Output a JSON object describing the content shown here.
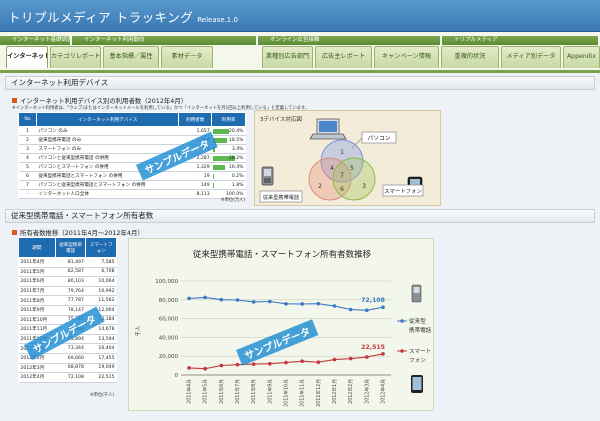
{
  "app": {
    "title": "トリプルメディア トラッキング",
    "release": "Release.1.0"
  },
  "nav": {
    "groups": [
      {
        "label": "インターネット基礎調査",
        "left": 0,
        "width": 72
      },
      {
        "label": "インターネット利用動向",
        "left": 72,
        "width": 186
      },
      {
        "label": "オンライン広告接触",
        "left": 258,
        "width": 184
      },
      {
        "label": "トリプルメディア",
        "left": 442,
        "width": 158
      }
    ],
    "tabs": [
      {
        "label": "インターネット入口",
        "active": true
      },
      {
        "label": "カテゴリレポート",
        "active": false
      },
      {
        "label": "基本指標／属性",
        "active": false
      },
      {
        "label": "素材データ",
        "active": false
      },
      {
        "label": "業種別広告部門",
        "active": false
      },
      {
        "label": "広告主レポート",
        "active": false
      },
      {
        "label": "キャンペーン情報",
        "active": false
      },
      {
        "label": "重複的状況",
        "active": false
      },
      {
        "label": "メディア別データ",
        "active": false
      },
      {
        "label": "Appendix",
        "active": false
      }
    ]
  },
  "sections": {
    "devices_title": "インターネット利用デバイス",
    "device_table_title": "インターネット利用デバイス別の利用者数（2012年4月）",
    "device_note": "※インターネット利用者は、「ウェブ)またはインターネットメールを利用している」かつ「インターネットを月1回以上利用している」と定義しています。",
    "device_unit": "※単位(万人)",
    "mobile_title": "従来型携帯電話・スマートフォン所有者数",
    "mobile_table_title": "所有者数推移（2011年4月〜2012年4月）",
    "mobile_unit": "※単位(千人)"
  },
  "device_table": {
    "headers": [
      "No",
      "インターネット利用デバイス",
      "利用者数",
      "利用率"
    ],
    "rows": [
      {
        "no": "1",
        "device": "パソコン のみ",
        "count": "1,657",
        "pct": "20.4%",
        "pct_value": 20.4
      },
      {
        "no": "2",
        "device": "従来型携帯電話 のみ",
        "count": "1,504",
        "pct": "18.5%",
        "pct_value": 18.5
      },
      {
        "no": "3",
        "device": "スマートフォン のみ",
        "count": "274",
        "pct": "3.4%",
        "pct_value": 3.4
      },
      {
        "no": "4",
        "device": "パソコンと従来型携帯電話 の併用",
        "count": "2,287",
        "pct": "28.2%",
        "pct_value": 28.2
      },
      {
        "no": "5",
        "device": "パソコンとスマートフォン の併用",
        "count": "1,329",
        "pct": "16.4%",
        "pct_value": 16.4
      },
      {
        "no": "6",
        "device": "従来型携帯電話とスマートフォン の併用",
        "count": "19",
        "pct": "0.2%",
        "pct_value": 0.2
      },
      {
        "no": "7",
        "device": "パソコンと従来型携帯電話とスマートフォン の併用",
        "count": "149",
        "pct": "1.8%",
        "pct_value": 1.8
      }
    ],
    "total": {
      "no": "-",
      "device": "インターネット人口全体",
      "count": "8,113",
      "pct": "100.0%"
    }
  },
  "venn": {
    "title": "3デバイス対応図",
    "labels": {
      "pc": "パソコン",
      "feature": "従来型携帯電話",
      "smart": "スマートフォン"
    },
    "regions": [
      "1",
      "2",
      "3",
      "4",
      "5",
      "6",
      "7"
    ]
  },
  "mobile_table": {
    "headers": [
      "期間",
      "従来型携帯電話",
      "スマートフォン"
    ],
    "rows": [
      [
        "2011年4月",
        "81,497",
        "7,585"
      ],
      [
        "2011年5月",
        "82,587",
        "6,708"
      ],
      [
        "2011年6月",
        "80,103",
        "10,064"
      ],
      [
        "2011年7月",
        "79,764",
        "10,992"
      ],
      [
        "2011年8月",
        "77,787",
        "11,562"
      ],
      [
        "2011年9月",
        "78,147",
        "12,004"
      ],
      [
        "2011年10月",
        "75,710",
        "13,184"
      ],
      [
        "2011年11月",
        "75,548",
        "14,678"
      ],
      [
        "2011年12月",
        "75,894",
        "13,594"
      ],
      [
        "2012年1月",
        "73,344",
        "16,404"
      ],
      [
        "2012年2月",
        "69,660",
        "17,455"
      ],
      [
        "2012年3月",
        "68,878",
        "19,049"
      ],
      [
        "2012年4月",
        "72,108",
        "22,515"
      ]
    ]
  },
  "watermark": "サンプルデータ",
  "chart_data": {
    "type": "line",
    "title": "従来型携帯電話・スマートフォン所有者数推移",
    "ylabel": "千人",
    "categories": [
      "2011年4月",
      "2011年5月",
      "2011年6月",
      "2011年7月",
      "2011年8月",
      "2011年9月",
      "2011年10月",
      "2011年11月",
      "2011年12月",
      "2012年1月",
      "2012年2月",
      "2012年3月",
      "2012年4月"
    ],
    "ylim": [
      0,
      100000
    ],
    "yticks": [
      "0",
      "20,000",
      "40,000",
      "60,000",
      "80,000",
      "100,000"
    ],
    "series": [
      {
        "name": "従来型携帯電話",
        "color": "#3a78c2",
        "values": [
          81497,
          82587,
          80103,
          79764,
          77787,
          78147,
          75710,
          75548,
          75894,
          73344,
          69660,
          68878,
          72108
        ],
        "last_label": "72,108"
      },
      {
        "name": "スマートフォン",
        "color": "#c0393b",
        "values": [
          7585,
          6708,
          10064,
          10992,
          11562,
          12004,
          13184,
          14678,
          13594,
          16404,
          17455,
          19049,
          22515
        ],
        "last_label": "22,515"
      }
    ],
    "legend": "right"
  },
  "colors": {
    "header": "#3a78b4",
    "nav_green": "#6a9a3f",
    "table_header": "#1f6bb0",
    "pct_bar": "#5db84e",
    "accent": "#d95a1f"
  },
  "icons": [
    "laptop-icon",
    "feature-phone-icon",
    "smartphone-icon"
  ]
}
